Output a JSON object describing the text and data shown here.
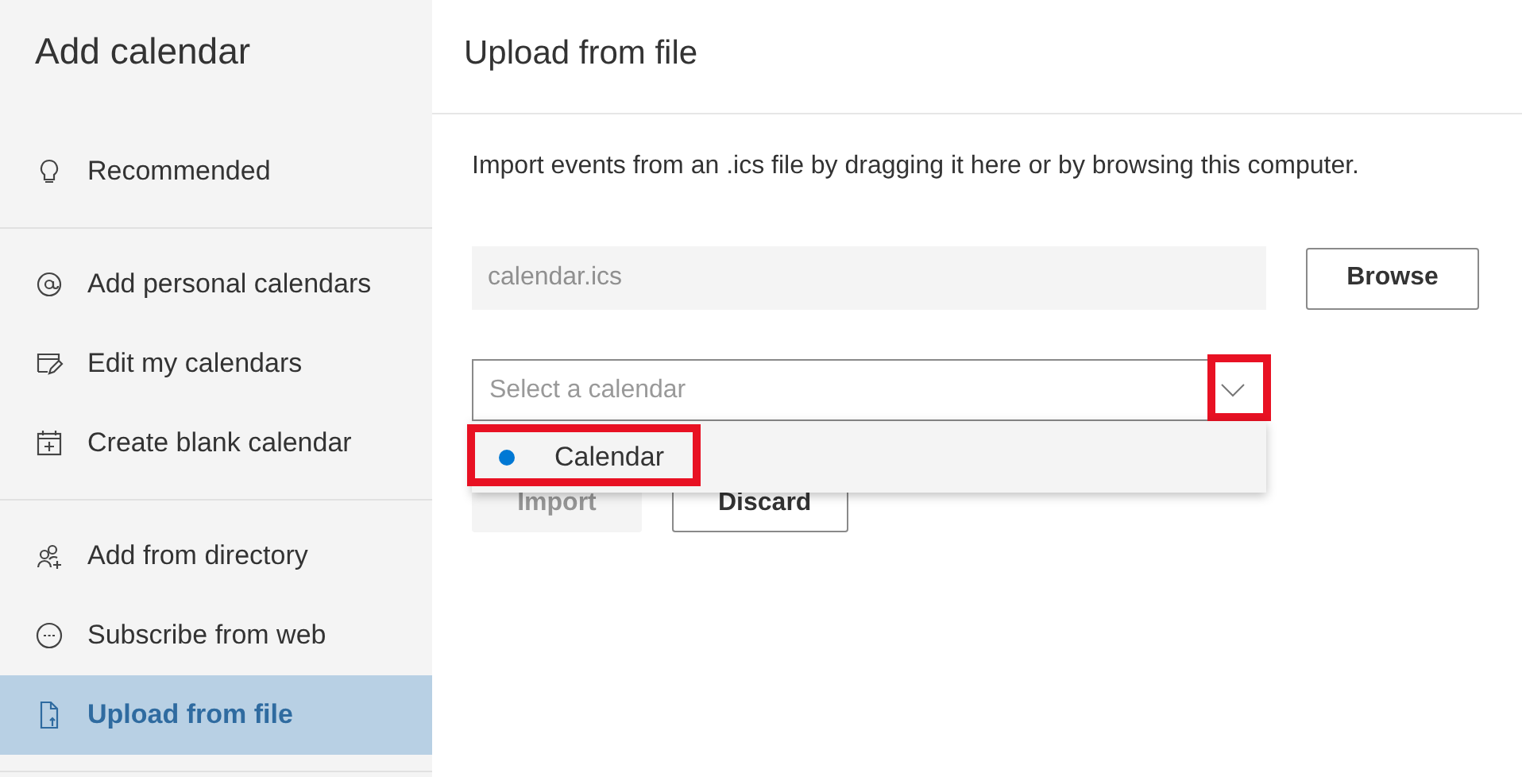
{
  "sidebar": {
    "title": "Add calendar",
    "groups": [
      [
        {
          "label": "Recommended",
          "kind": "bulb",
          "selected": false
        }
      ],
      [
        {
          "label": "Add personal calendars",
          "kind": "at",
          "selected": false
        },
        {
          "label": "Edit my calendars",
          "kind": "edit",
          "selected": false
        },
        {
          "label": "Create blank calendar",
          "kind": "calplus",
          "selected": false
        }
      ],
      [
        {
          "label": "Add from directory",
          "kind": "people",
          "selected": false
        },
        {
          "label": "Subscribe from web",
          "kind": "web",
          "selected": false
        },
        {
          "label": "Upload from file",
          "kind": "file",
          "selected": true
        }
      ]
    ]
  },
  "main": {
    "title": "Upload from file",
    "description": "Import events from an .ics file by dragging it here or by browsing this computer.",
    "file_field": {
      "placeholder": "calendar.ics"
    },
    "browse_button": "Browse",
    "calendar_select": {
      "placeholder": "Select a calendar",
      "expanded": true,
      "options": [
        {
          "label": "Calendar",
          "color": "#0078d4"
        }
      ]
    },
    "buttons": [
      {
        "label": "Import",
        "disabled": true
      },
      {
        "label": "Discard",
        "disabled": false
      }
    ]
  }
}
